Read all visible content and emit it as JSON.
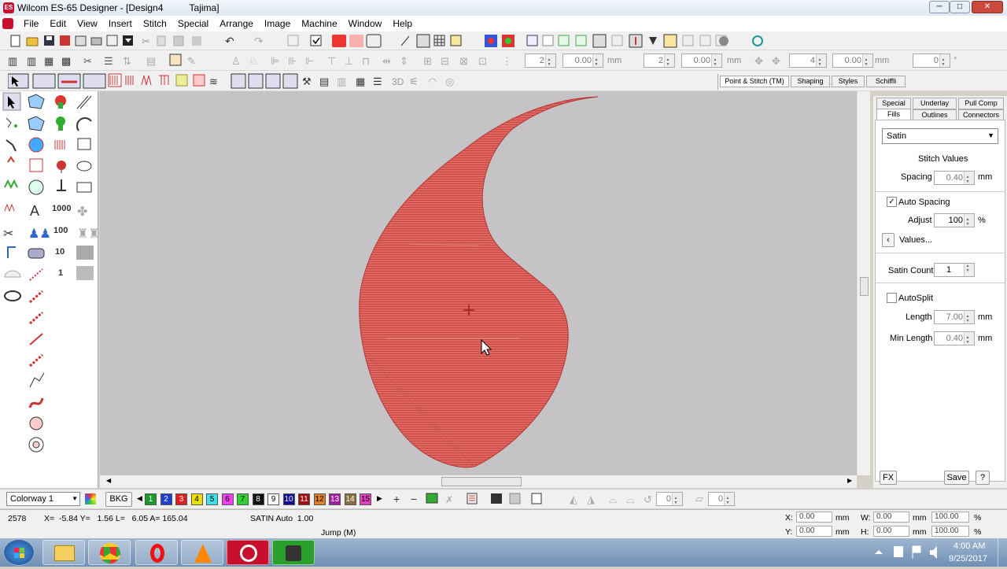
{
  "window": {
    "title": "Wilcom ES-65 Designer - [Design4          Tajima]",
    "minimize": "─",
    "maximize": "□",
    "close": "✕"
  },
  "menu": [
    "File",
    "Edit",
    "View",
    "Insert",
    "Stitch",
    "Special",
    "Arrange",
    "Image",
    "Machine",
    "Window",
    "Help"
  ],
  "toolbar2": {
    "field1": "2",
    "field2": "0.00",
    "unit2": "mm",
    "field3": "2",
    "field4": "0.00",
    "unit4": "mm",
    "field5": "4",
    "field6": "0.00",
    "unit6": "mm",
    "field7": "0",
    "unit7": "°"
  },
  "toolbar3": {
    "label_3d": "3D"
  },
  "shape_tabs": [
    "Point & Stitch (TM)",
    "Shaping",
    "Styles",
    "Schiffli"
  ],
  "left_tools": {
    "n1000": "1000",
    "n100": "100",
    "n10": "10",
    "n1": "1"
  },
  "panel": {
    "tabs_top": [
      "Special",
      "Underlay",
      "Pull Comp"
    ],
    "tabs_bottom": [
      "Fills",
      "Outlines",
      "Connectors"
    ],
    "fill_type": "Satin",
    "section_title": "Stitch Values",
    "spacing_label": "Spacing",
    "spacing_value": "0.40",
    "spacing_unit": "mm",
    "auto_spacing_label": "Auto Spacing",
    "auto_spacing_checked": true,
    "adjust_label": "Adjust",
    "adjust_value": "100",
    "adjust_unit": "%",
    "values_button": "Values...",
    "satin_count_label": "Satin Count",
    "satin_count_value": "1",
    "autosplit_label": "AutoSplit",
    "autosplit_checked": false,
    "length_label": "Length",
    "length_value": "7.00",
    "length_unit": "mm",
    "minlength_label": "Min Length",
    "minlength_value": "0.40",
    "minlength_unit": "mm",
    "fx_button": "FX",
    "save_button": "Save",
    "help_button": "?"
  },
  "colorbar": {
    "colorway": "Colorway 1",
    "bkg": "BKG",
    "swatches": [
      {
        "n": "1",
        "c": "#1a9a2a"
      },
      {
        "n": "2",
        "c": "#1f3fd0"
      },
      {
        "n": "3",
        "c": "#e02020"
      },
      {
        "n": "4",
        "c": "#f0e000"
      },
      {
        "n": "5",
        "c": "#40e0e8"
      },
      {
        "n": "6",
        "c": "#f040f0"
      },
      {
        "n": "7",
        "c": "#30d030"
      },
      {
        "n": "8",
        "c": "#101010"
      },
      {
        "n": "9",
        "c": "#ffffff"
      },
      {
        "n": "10",
        "c": "#101090"
      },
      {
        "n": "11",
        "c": "#a01010"
      },
      {
        "n": "12",
        "c": "#e08020"
      },
      {
        "n": "13",
        "c": "#a020a0"
      },
      {
        "n": "14",
        "c": "#8a7040"
      },
      {
        "n": "15",
        "c": "#e040c0"
      }
    ],
    "field_a": "0",
    "field_b": "0"
  },
  "status": {
    "stitch_count": "2578",
    "coords": "X=  -5.84 Y=   1.56 L=   6.05 A= 165.04",
    "stitch_type": "SATIN Auto  1.00",
    "jump": "Jump (M)",
    "x_label": "X:",
    "x_value": "0.00",
    "x_unit": "mm",
    "y_label": "Y:",
    "y_value": "0.00",
    "y_unit": "mm",
    "w_label": "W:",
    "w_value": "0.00",
    "w_unit": "mm",
    "w_pct": "100.00",
    "w_pct_unit": "%",
    "h_label": "H:",
    "h_value": "0.00",
    "h_unit": "mm",
    "h_pct": "100.00",
    "h_pct_unit": "%"
  },
  "taskbar": {
    "time": "4:00 AM",
    "date": "9/25/2017"
  },
  "colors": {
    "stitch": "#e05a56",
    "stitch_dark": "#b83a38",
    "canvas": "#c6c3c6"
  }
}
